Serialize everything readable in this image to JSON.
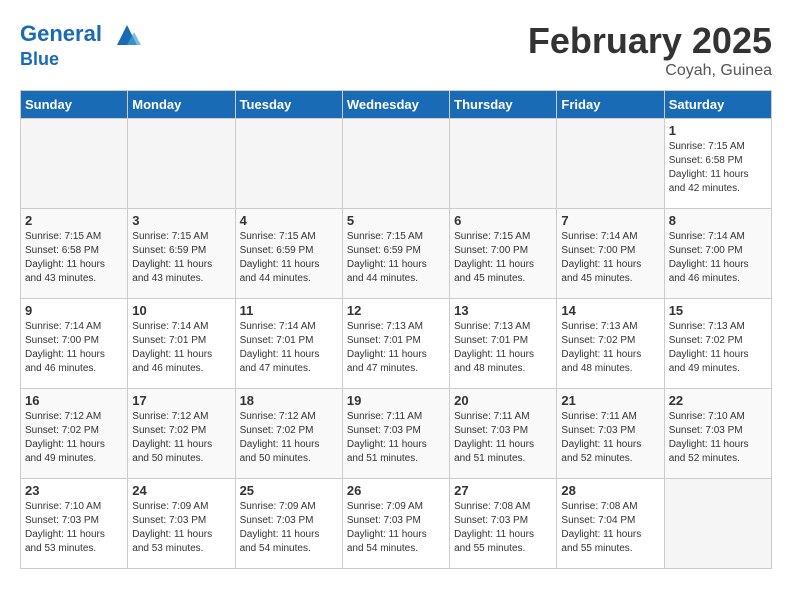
{
  "logo": {
    "line1": "General",
    "line2": "Blue"
  },
  "title": "February 2025",
  "subtitle": "Coyah, Guinea",
  "days_of_week": [
    "Sunday",
    "Monday",
    "Tuesday",
    "Wednesday",
    "Thursday",
    "Friday",
    "Saturday"
  ],
  "weeks": [
    [
      {
        "day": "",
        "info": ""
      },
      {
        "day": "",
        "info": ""
      },
      {
        "day": "",
        "info": ""
      },
      {
        "day": "",
        "info": ""
      },
      {
        "day": "",
        "info": ""
      },
      {
        "day": "",
        "info": ""
      },
      {
        "day": "1",
        "info": "Sunrise: 7:15 AM\nSunset: 6:58 PM\nDaylight: 11 hours\nand 42 minutes."
      }
    ],
    [
      {
        "day": "2",
        "info": "Sunrise: 7:15 AM\nSunset: 6:58 PM\nDaylight: 11 hours\nand 43 minutes."
      },
      {
        "day": "3",
        "info": "Sunrise: 7:15 AM\nSunset: 6:59 PM\nDaylight: 11 hours\nand 43 minutes."
      },
      {
        "day": "4",
        "info": "Sunrise: 7:15 AM\nSunset: 6:59 PM\nDaylight: 11 hours\nand 44 minutes."
      },
      {
        "day": "5",
        "info": "Sunrise: 7:15 AM\nSunset: 6:59 PM\nDaylight: 11 hours\nand 44 minutes."
      },
      {
        "day": "6",
        "info": "Sunrise: 7:15 AM\nSunset: 7:00 PM\nDaylight: 11 hours\nand 45 minutes."
      },
      {
        "day": "7",
        "info": "Sunrise: 7:14 AM\nSunset: 7:00 PM\nDaylight: 11 hours\nand 45 minutes."
      },
      {
        "day": "8",
        "info": "Sunrise: 7:14 AM\nSunset: 7:00 PM\nDaylight: 11 hours\nand 46 minutes."
      }
    ],
    [
      {
        "day": "9",
        "info": "Sunrise: 7:14 AM\nSunset: 7:00 PM\nDaylight: 11 hours\nand 46 minutes."
      },
      {
        "day": "10",
        "info": "Sunrise: 7:14 AM\nSunset: 7:01 PM\nDaylight: 11 hours\nand 46 minutes."
      },
      {
        "day": "11",
        "info": "Sunrise: 7:14 AM\nSunset: 7:01 PM\nDaylight: 11 hours\nand 47 minutes."
      },
      {
        "day": "12",
        "info": "Sunrise: 7:13 AM\nSunset: 7:01 PM\nDaylight: 11 hours\nand 47 minutes."
      },
      {
        "day": "13",
        "info": "Sunrise: 7:13 AM\nSunset: 7:01 PM\nDaylight: 11 hours\nand 48 minutes."
      },
      {
        "day": "14",
        "info": "Sunrise: 7:13 AM\nSunset: 7:02 PM\nDaylight: 11 hours\nand 48 minutes."
      },
      {
        "day": "15",
        "info": "Sunrise: 7:13 AM\nSunset: 7:02 PM\nDaylight: 11 hours\nand 49 minutes."
      }
    ],
    [
      {
        "day": "16",
        "info": "Sunrise: 7:12 AM\nSunset: 7:02 PM\nDaylight: 11 hours\nand 49 minutes."
      },
      {
        "day": "17",
        "info": "Sunrise: 7:12 AM\nSunset: 7:02 PM\nDaylight: 11 hours\nand 50 minutes."
      },
      {
        "day": "18",
        "info": "Sunrise: 7:12 AM\nSunset: 7:02 PM\nDaylight: 11 hours\nand 50 minutes."
      },
      {
        "day": "19",
        "info": "Sunrise: 7:11 AM\nSunset: 7:03 PM\nDaylight: 11 hours\nand 51 minutes."
      },
      {
        "day": "20",
        "info": "Sunrise: 7:11 AM\nSunset: 7:03 PM\nDaylight: 11 hours\nand 51 minutes."
      },
      {
        "day": "21",
        "info": "Sunrise: 7:11 AM\nSunset: 7:03 PM\nDaylight: 11 hours\nand 52 minutes."
      },
      {
        "day": "22",
        "info": "Sunrise: 7:10 AM\nSunset: 7:03 PM\nDaylight: 11 hours\nand 52 minutes."
      }
    ],
    [
      {
        "day": "23",
        "info": "Sunrise: 7:10 AM\nSunset: 7:03 PM\nDaylight: 11 hours\nand 53 minutes."
      },
      {
        "day": "24",
        "info": "Sunrise: 7:09 AM\nSunset: 7:03 PM\nDaylight: 11 hours\nand 53 minutes."
      },
      {
        "day": "25",
        "info": "Sunrise: 7:09 AM\nSunset: 7:03 PM\nDaylight: 11 hours\nand 54 minutes."
      },
      {
        "day": "26",
        "info": "Sunrise: 7:09 AM\nSunset: 7:03 PM\nDaylight: 11 hours\nand 54 minutes."
      },
      {
        "day": "27",
        "info": "Sunrise: 7:08 AM\nSunset: 7:03 PM\nDaylight: 11 hours\nand 55 minutes."
      },
      {
        "day": "28",
        "info": "Sunrise: 7:08 AM\nSunset: 7:04 PM\nDaylight: 11 hours\nand 55 minutes."
      },
      {
        "day": "",
        "info": ""
      }
    ]
  ]
}
